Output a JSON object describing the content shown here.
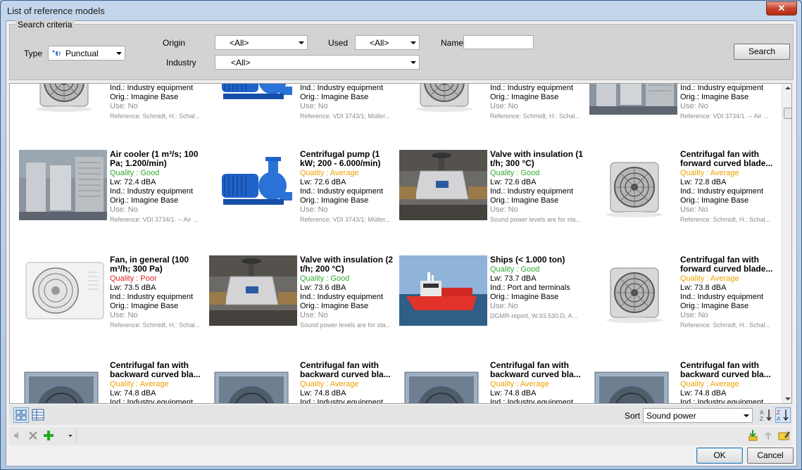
{
  "window": {
    "title": "List of reference models",
    "close_label": "✕"
  },
  "criteria": {
    "legend": "Search criteria",
    "type_label": "Type",
    "type_value": "Punctual",
    "origin_label": "Origin",
    "origin_value": "<All>",
    "used_label": "Used",
    "used_value": "<All>",
    "name_label": "Name",
    "name_value": "",
    "industry_label": "Industry",
    "industry_value": "<All>",
    "search_label": "Search"
  },
  "top_partial": [
    {
      "ind": "Ind.: Industry equipment",
      "orig": "Orig.: Imagine Base",
      "use": "Use: No",
      "ref": "Reference: Schmidt, H.: Schal...",
      "img": "fan"
    },
    {
      "ind": "Ind.: Industry equipment",
      "orig": "Orig.: Imagine Base",
      "use": "Use: No",
      "ref": "Reference: VDI 3743/1; Müller...",
      "img": "pump"
    },
    {
      "ind": "Ind.: Industry equipment",
      "orig": "Orig.: Imagine Base",
      "use": "Use: No",
      "ref": "Reference: Schmidt, H.: Schal...",
      "img": "fan"
    },
    {
      "ind": "Ind.: Industry equipment",
      "orig": "Orig.: Imagine Base",
      "use": "Use: No",
      "ref": "Reference: VDI 3734/1. -- Air ...",
      "img": "cooler"
    }
  ],
  "rows": [
    [
      {
        "name": "Air cooler (1 m³/s; 100 Pa; 1.200/min)",
        "quality": "Quality : Good",
        "qclass": "good",
        "lw": "Lw: 72.4 dBA",
        "ind": "Ind.: Industry equipment",
        "orig": "Orig.: Imagine Base",
        "use": "Use: No",
        "ref": "Reference: VDI 3734/1. -- Air ...",
        "img": "cooler"
      },
      {
        "name": "Centrifugal pump (1 kW; 200 - 6.000/min)",
        "quality": "Quality : Average",
        "qclass": "avg",
        "lw": "Lw: 72.6 dBA",
        "ind": "Ind.: Industry equipment",
        "orig": "Orig.: Imagine Base",
        "use": "Use: No",
        "ref": "Reference: VDI 3743/1; Müller...",
        "img": "pump"
      },
      {
        "name": "Valve with insulation (1 t/h; 300 °C)",
        "quality": "Quality : Good",
        "qclass": "good",
        "lw": "Lw: 72.6 dBA",
        "ind": "Ind.: Industry equipment",
        "orig": "Orig.: Imagine Base",
        "use": "Use: No",
        "ref": "Sound power levels are for sta...",
        "img": "valve"
      },
      {
        "name": "Centrifugal fan with forward curved blade...",
        "quality": "Quality : Average",
        "qclass": "avg",
        "lw": "Lw: 72.8 dBA",
        "ind": "Ind.: Industry equipment",
        "orig": "Orig.: Imagine Base",
        "use": "Use: No",
        "ref": "Reference: Schmidt, H.: Schal...",
        "img": "fan"
      }
    ],
    [
      {
        "name": "Fan, in general (100 m³/h; 300 Pa)",
        "quality": "Quality : Poor",
        "qclass": "poor",
        "lw": "Lw: 73.5 dBA",
        "ind": "Ind.: Industry equipment",
        "orig": "Orig.: Imagine Base",
        "use": "Use: No",
        "ref": "Reference: Schmidt, H.: Schal...",
        "img": "ac"
      },
      {
        "name": "Valve with insulation (2 t/h; 200 °C)",
        "quality": "Quality : Good",
        "qclass": "good",
        "lw": "Lw: 73.6 dBA",
        "ind": "Ind.: Industry equipment",
        "orig": "Orig.: Imagine Base",
        "use": "Use: No",
        "ref": "Sound power levels are for sta...",
        "img": "valve"
      },
      {
        "name": "Ships (< 1.000 ton)",
        "quality": "Quality : Good",
        "qclass": "good",
        "lw": "Lw: 73.7 dBA",
        "ind": "Ind.: Port and terminals",
        "orig": "Orig.: Imagine Base",
        "use": "Use: No",
        "ref": "DGMR-report, W.93.530.D, A...",
        "img": "ship"
      },
      {
        "name": "Centrifugal fan with forward curved blade...",
        "quality": "Quality : Average",
        "qclass": "avg",
        "lw": "Lw: 73.8 dBA",
        "ind": "Ind.: Industry equipment",
        "orig": "Orig.: Imagine Base",
        "use": "Use: No",
        "ref": "Reference: Schmidt, H.: Schal...",
        "img": "fan"
      }
    ],
    [
      {
        "name": "Centrifugal fan with backward curved bla...",
        "quality": "Quality : Average",
        "qclass": "avg",
        "lw": "Lw: 74.8 dBA",
        "ind": "Ind.: Industry equipment",
        "img": "boxfan"
      },
      {
        "name": "Centrifugal fan with backward curved bla...",
        "quality": "Quality : Average",
        "qclass": "avg",
        "lw": "Lw: 74.8 dBA",
        "ind": "Ind.: Industry equipment",
        "img": "boxfan"
      },
      {
        "name": "Centrifugal fan with backward curved bla...",
        "quality": "Quality : Average",
        "qclass": "avg",
        "lw": "Lw: 74.8 dBA",
        "ind": "Ind.: Industry equipment",
        "img": "boxfan"
      },
      {
        "name": "Centrifugal fan with backward curved bla...",
        "quality": "Quality : Average",
        "qclass": "avg",
        "lw": "Lw: 74.8 dBA",
        "ind": "Ind.: Industry equipment",
        "img": "boxfan"
      }
    ]
  ],
  "sort": {
    "label": "Sort",
    "value": "Sound power"
  },
  "footer": {
    "ok_label": "OK",
    "cancel_label": "Cancel"
  },
  "colors": {
    "good": "#2fa82f",
    "avg": "#f0a000",
    "poor": "#e02020"
  }
}
